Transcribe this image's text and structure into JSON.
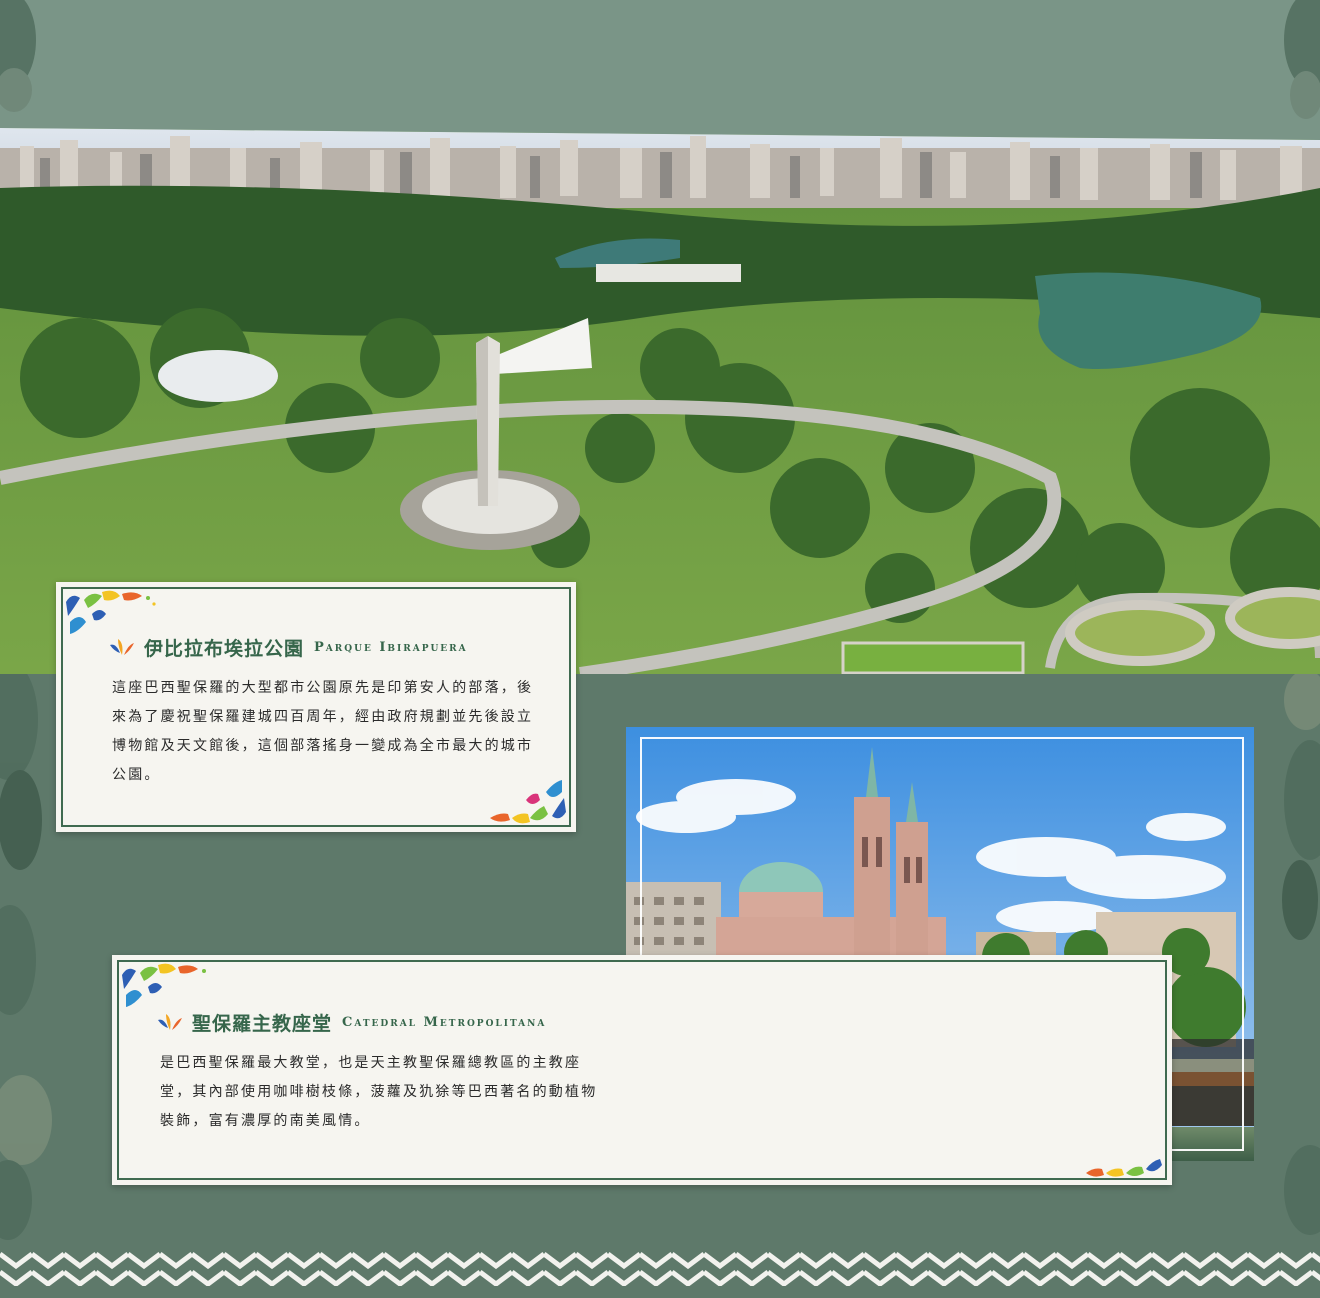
{
  "colors": {
    "background": "#5e796a",
    "card_background": "#f6f5f0",
    "card_border": "#3f6a50",
    "title_green": "#36664b",
    "zigzag_white": "#f2f2ee"
  },
  "ibirapuera": {
    "title_zh": "伊比拉布埃拉公園",
    "title_en": "Parque Ibirapuera",
    "body": "這座巴西聖保羅的大型都市公園原先是印第安人的部落，後來為了慶祝聖保羅建城四百周年，經由政府規劃並先後設立博物館及天文館後，這個部落搖身一變成為全市最大的城市公園。",
    "icon": "colorful-brushstroke-logo-icon"
  },
  "catedral": {
    "title_zh": "聖保羅主教座堂",
    "title_en": "Catedral Metropolitana",
    "body": "是巴西聖保羅最大教堂，也是天主教聖保羅總教區的主教座堂，其內部使用咖啡樹枝條，菠蘿及犰狳等巴西著名的動植物裝飾，富有濃厚的南美風情。",
    "icon": "colorful-brushstroke-logo-icon"
  }
}
